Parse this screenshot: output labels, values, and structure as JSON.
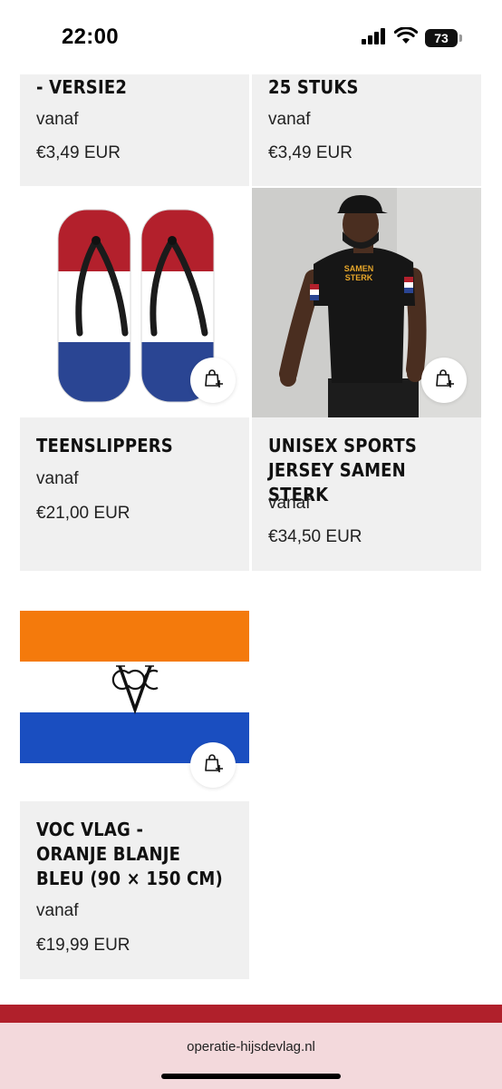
{
  "status_bar": {
    "time": "22:00",
    "battery_level": "73",
    "signal_icon": "cellular-signal-icon",
    "wifi_icon": "wifi-icon"
  },
  "products": [
    {
      "title": "- VERSIE2",
      "from_label": "vanaf",
      "price": "€3,49 EUR"
    },
    {
      "title": "25 STUKS",
      "from_label": "vanaf",
      "price": "€3,49 EUR"
    },
    {
      "title": "TEENSLIPPERS",
      "from_label": "vanaf",
      "price": "€21,00 EUR",
      "quick_add_icon": "bag-plus-icon"
    },
    {
      "title_lines": [
        "UNISEX SPORTS",
        "JERSEY SAMEN STERK"
      ],
      "from_label": "vanaf",
      "price": "€34,50 EUR",
      "shirt_print": [
        "SAMEN",
        "STERK"
      ],
      "quick_add_icon": "bag-plus-icon"
    },
    {
      "title_lines": [
        "VOC VLAG -",
        "ORANJE BLANJE",
        "BLEU (90 × 150 CM)"
      ],
      "from_label": "vanaf",
      "price": "€19,99 EUR",
      "quick_add_icon": "bag-plus-icon"
    }
  ],
  "colors": {
    "card_bg": "#f0f0f0",
    "footer_band": "#b0202b",
    "url_bar_bg": "#f3d9dc",
    "flag_orange": "#f47a0c",
    "flag_blue": "#1a4ec0",
    "flag_red": "#b3202c",
    "nl_blue": "#2a4593"
  },
  "browser": {
    "url": "operatie-hijsdevlag.nl"
  }
}
